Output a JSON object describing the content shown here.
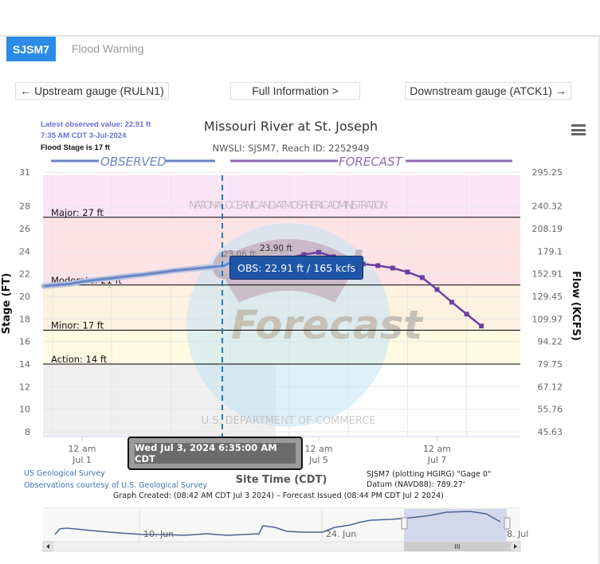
{
  "tabs": [
    {
      "label": "SJSM7",
      "active": true
    },
    {
      "label": "Flood Warning",
      "active": false
    }
  ],
  "nav": {
    "upstream": "← Upstream gauge (RULN1)",
    "full_info": "Full Information >",
    "downstream": "Downstream gauge (ATCK1) →"
  },
  "info": {
    "latest": "Latest observed value: 22.91 ft",
    "latest_time": "7:35 AM CDT 3-Jul-2024",
    "flood_stage": "Flood Stage is 17 ft"
  },
  "colors": {
    "tab_active": "#2b8be6",
    "observed": "#6a86c4",
    "forecast": "#6b3fa0",
    "info_text": "#6a6fd6",
    "tooltip_bg": "#1f56a8",
    "major_band": "#fbe4f7",
    "moderate_band": "#fde3e6",
    "minor_band": "#fdf1e0",
    "action_band": "#fefbe3",
    "below_band": "#efefef",
    "link": "#3a73b8"
  },
  "chart_data": {
    "type": "line",
    "title": "Missouri River at St. Joseph",
    "subtitle": "NWSLI: SJSM7, Reach ID: 2252949",
    "legend": {
      "observed": "OBSERVED",
      "forecast": "FORECAST",
      "placement": "top"
    },
    "ylabel": "Stage (FT)",
    "y2label": "Flow (KCFS)",
    "xlabel": "Site Time (CDT)",
    "ylim": [
      8,
      31
    ],
    "y_ticks": [
      8,
      10,
      12,
      14,
      16,
      18,
      20,
      22,
      24,
      26,
      28,
      31
    ],
    "y2_ticks": [
      "45.63",
      "55.76",
      "67.12",
      "79.75",
      "94.22",
      "109.97",
      "129.45",
      "152.91",
      "179.1",
      "208.19",
      "240.32",
      "295.25"
    ],
    "x_range_days": [
      -0.65,
      7.4
    ],
    "x_ticks": [
      {
        "day": 0,
        "line1": "12 am",
        "line2": "Jul 1"
      },
      {
        "day": 2,
        "line1": "",
        "line2": ""
      },
      {
        "day": 4,
        "line1": "12 am",
        "line2": "Jul 5"
      },
      {
        "day": 6,
        "line1": "12 am",
        "line2": "Jul 7"
      }
    ],
    "flood_categories": [
      {
        "name": "Major",
        "label": "Major: 27 ft",
        "stage": 27
      },
      {
        "name": "Moderate",
        "label": "Moderate: 21 ft",
        "stage": 21
      },
      {
        "name": "Minor",
        "label": "Minor: 17 ft",
        "stage": 17
      },
      {
        "name": "Action",
        "label": "Action: 14 ft",
        "stage": 14
      }
    ],
    "series": [
      {
        "name": "Observed",
        "x_days": [
          -0.65,
          -0.45,
          -0.2,
          0.0,
          0.3,
          0.5,
          0.8,
          1.0,
          1.3,
          1.6,
          1.8,
          2.0,
          2.2,
          2.4,
          2.5,
          2.65,
          2.85,
          3.0,
          3.27
        ],
        "values": [
          20.9,
          21.0,
          21.1,
          21.3,
          21.5,
          21.6,
          21.8,
          21.9,
          22.1,
          22.3,
          22.4,
          22.5,
          22.6,
          22.7,
          22.95,
          23.06,
          22.95,
          22.93,
          22.91
        ]
      },
      {
        "name": "Forecast",
        "x_days": [
          3.25,
          3.5,
          3.75,
          4.0,
          4.25,
          4.5,
          4.75,
          5.0,
          5.25,
          5.5,
          5.75,
          6.0,
          6.25,
          6.5,
          6.75
        ],
        "values": [
          23.0,
          23.4,
          23.7,
          23.9,
          23.5,
          23.1,
          22.86,
          22.72,
          22.5,
          22.15,
          21.66,
          20.6,
          19.48,
          18.42,
          17.37
        ]
      }
    ],
    "annotations": {
      "obs_peak": {
        "label": "23.06 ft",
        "day": 2.65,
        "stage": 23.06
      },
      "fcst_peak": {
        "label": "23.90 ft",
        "day": 4.0,
        "stage": 23.9
      },
      "current_time_day": 3.274
    },
    "tooltip": {
      "text": "OBS: 22.91 ft / 165 kcfs"
    },
    "crosshair_label": "Wed Jul 3, 2024 6:35:00 AM CDT"
  },
  "footer": {
    "source1": "US Geological Survey",
    "source2": "Observations courtesy of U.S. Geological Survey",
    "datum1": "SJSM7 (plotting HGIRG) \"Gage 0\"",
    "datum2": "Datum (NAVD88): 789.27'",
    "created": "Graph Created: (08:42 AM CDT Jul 3 2024) – Forecast Issued (08:44 PM CDT Jul 2 2024)"
  },
  "watermark": {
    "ring_text_top": "NATIONAL OCEANIC AND ATMOSPHERIC ADMINISTRATION",
    "ring_text_bottom": "U.S. DEPARTMENT OF COMMERCE",
    "line1": "Official",
    "line2": "Forecast"
  },
  "navigator": {
    "labels": [
      "10. Jun",
      "24. Jun",
      "8. Jul"
    ],
    "scroll_grip": "III"
  }
}
